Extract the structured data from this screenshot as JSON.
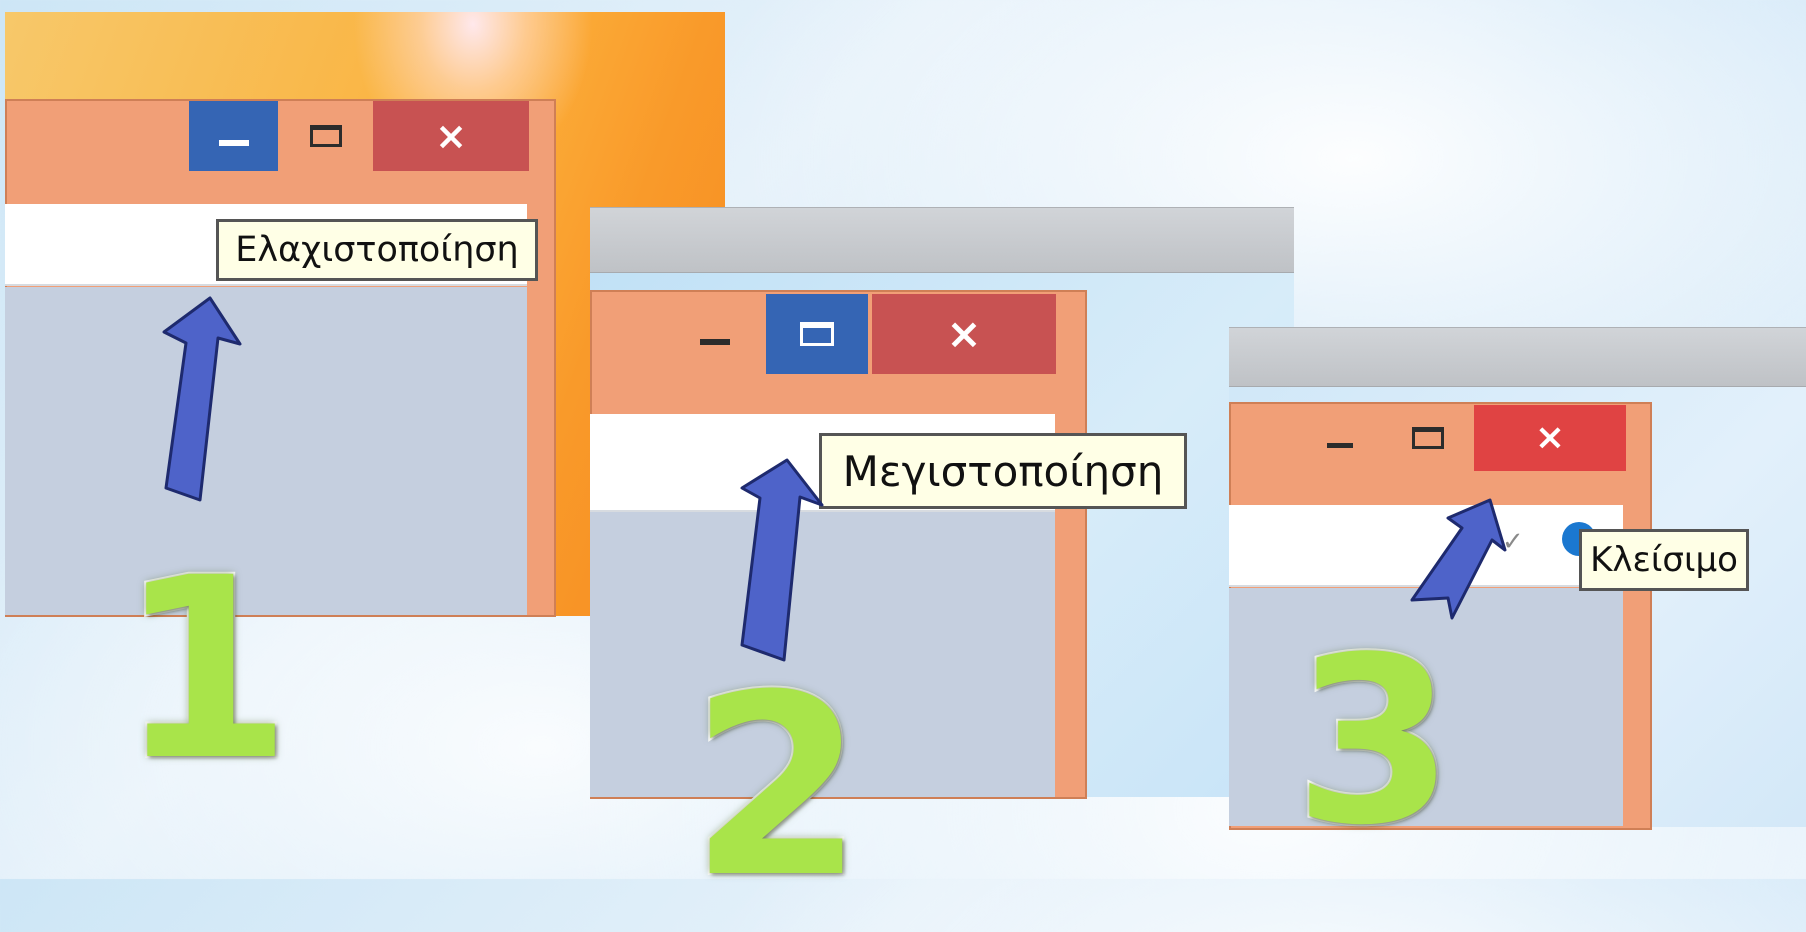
{
  "panels": [
    {
      "number": "1",
      "tooltip": "Ελαχιστοποίηση",
      "minimize_icon": "minimize-icon",
      "maximize_icon": "maximize-icon",
      "close_icon": "close-icon",
      "close_glyph": "×",
      "highlighted_button": "minimize"
    },
    {
      "number": "2",
      "tooltip": "Μεγιστοποίηση",
      "minimize_icon": "minimize-icon",
      "maximize_icon": "maximize-icon",
      "close_icon": "close-icon",
      "close_glyph": "×",
      "highlighted_button": "maximize"
    },
    {
      "number": "3",
      "tooltip": "Κλείσιμο",
      "minimize_icon": "minimize-icon",
      "maximize_icon": "maximize-icon",
      "close_icon": "close-icon",
      "close_glyph": "×",
      "highlighted_button": "close"
    }
  ],
  "colors": {
    "window_frame": "#f19f77",
    "highlight_blue": "#3565b4",
    "close_red": "#c85252",
    "close_red_hover": "#e04343",
    "arrow_blue": "#4e63c9",
    "number_green": "#a9e44a",
    "tooltip_bg": "#ffffe6"
  }
}
